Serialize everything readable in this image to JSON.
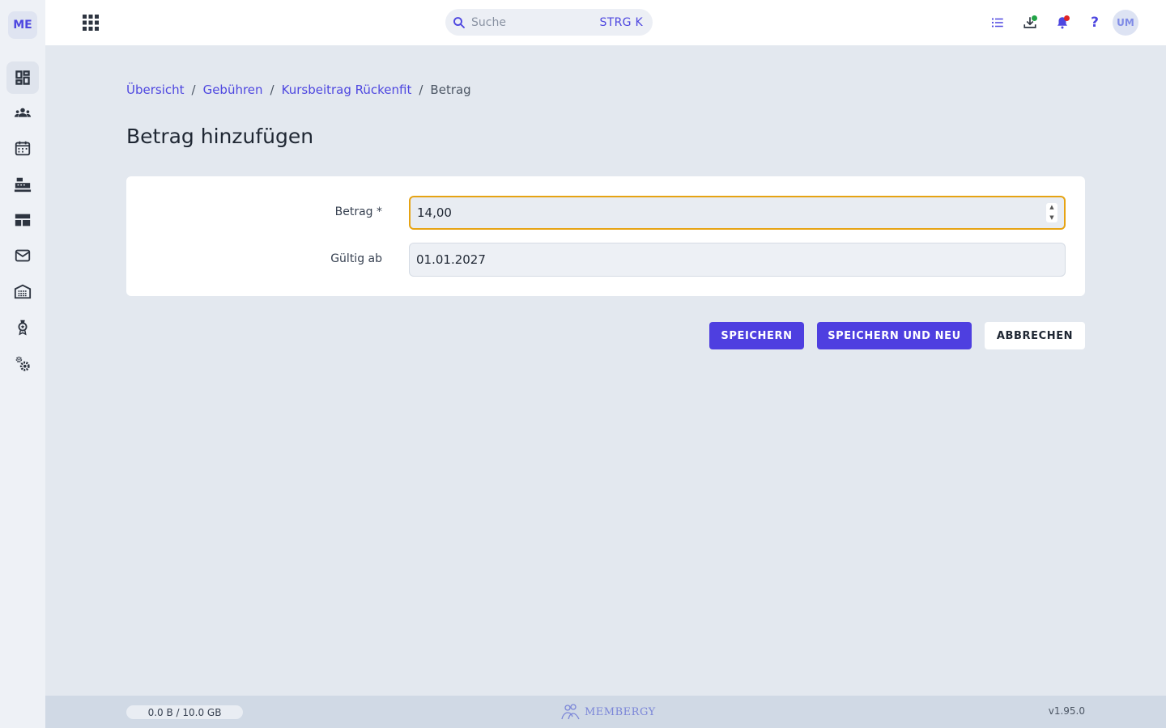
{
  "app": {
    "logo_text": "ME",
    "accent_color": "#4e47e0"
  },
  "sidebar": {
    "items": [
      {
        "name": "dashboard-icon",
        "active": true
      },
      {
        "name": "members-icon",
        "active": false
      },
      {
        "name": "calendar-icon",
        "active": false
      },
      {
        "name": "cash-register-icon",
        "active": false
      },
      {
        "name": "table-layout-icon",
        "active": false
      },
      {
        "name": "mail-icon",
        "active": false
      },
      {
        "name": "warehouse-icon",
        "active": false
      },
      {
        "name": "award-icon",
        "active": false
      },
      {
        "name": "settings-icon",
        "active": false
      }
    ]
  },
  "topbar": {
    "search_placeholder": "Suche",
    "search_shortcut": "STRG K",
    "help_label": "?",
    "avatar_initials": "UM"
  },
  "breadcrumb": {
    "items": [
      "Übersicht",
      "Gebühren",
      "Kursbeitrag Rückenfit"
    ],
    "separator": "/",
    "current": "Betrag"
  },
  "page": {
    "title": "Betrag hinzufügen"
  },
  "form": {
    "amount_label": "Betrag *",
    "amount_value": "14,00",
    "valid_from_label": "Gültig ab",
    "valid_from_value": "01.01.2027"
  },
  "actions": {
    "save": "SPEICHERN",
    "save_and_new": "SPEICHERN UND NEU",
    "cancel": "ABBRECHEN"
  },
  "footer": {
    "storage": "0.0 B / 10.0 GB",
    "brand": "MEMBERGY",
    "version": "v1.95.0"
  }
}
